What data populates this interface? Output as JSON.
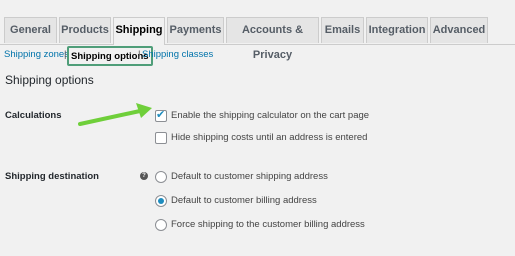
{
  "tabs": [
    {
      "label": "General",
      "active": false
    },
    {
      "label": "Products",
      "active": false
    },
    {
      "label": "Shipping",
      "active": true
    },
    {
      "label": "Payments",
      "active": false
    },
    {
      "label": "Accounts & Privacy",
      "active": false
    },
    {
      "label": "Emails",
      "active": false
    },
    {
      "label": "Integration",
      "active": false
    },
    {
      "label": "Advanced",
      "active": false
    }
  ],
  "subnav": {
    "shipping_zones": "Shipping zones",
    "shipping_options": "Shipping options",
    "shipping_classes": "Shipping classes",
    "separator": "|"
  },
  "section_title": "Shipping options",
  "calculations": {
    "label": "Calculations",
    "options": [
      {
        "label": "Enable the shipping calculator on the cart page",
        "checked": true
      },
      {
        "label": "Hide shipping costs until an address is entered",
        "checked": false
      }
    ]
  },
  "destination": {
    "label": "Shipping destination",
    "help_icon": "?",
    "options": [
      {
        "label": "Default to customer shipping address",
        "selected": false
      },
      {
        "label": "Default to customer billing address",
        "selected": true
      },
      {
        "label": "Force shipping to the customer billing address",
        "selected": false
      }
    ]
  },
  "colors": {
    "accent": "#1e8cbe",
    "link": "#0073aa",
    "highlight_box": "#4f9e79",
    "arrow": "#6fcf3a"
  }
}
